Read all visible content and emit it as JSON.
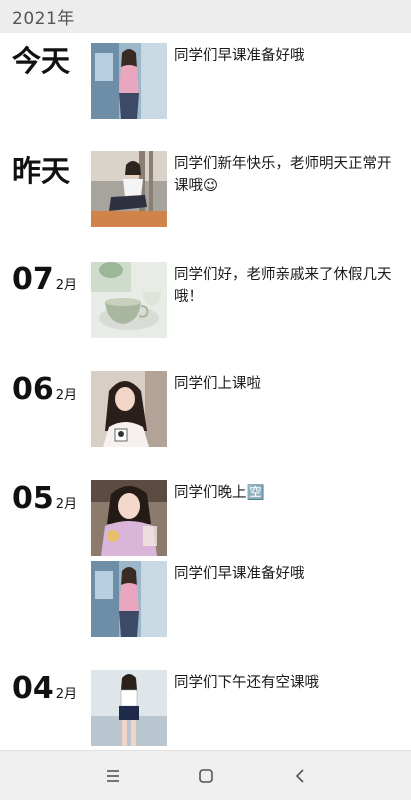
{
  "header": {
    "year": "2021年"
  },
  "days": [
    {
      "label": "今天",
      "posts": [
        {
          "text": "同学们早课准备好哦",
          "thumb": "photo-woman-window-pink"
        }
      ]
    },
    {
      "label": "昨天",
      "posts": [
        {
          "text": "同学们新年快乐，老师明天正常开课哦😉",
          "thumb": "photo-woman-gym-sitting"
        }
      ]
    },
    {
      "day": "07",
      "month": "2月",
      "posts": [
        {
          "text": "同学们好，老师亲戚来了休假几天哦！",
          "thumb": "photo-teacup"
        }
      ]
    },
    {
      "day": "06",
      "month": "2月",
      "posts": [
        {
          "text": "同学们上课啦",
          "thumb": "photo-woman-selfie"
        }
      ]
    },
    {
      "day": "05",
      "month": "2月",
      "posts": [
        {
          "text": "同学们晚上🈳",
          "thumb": "photo-woman-pink-dress"
        },
        {
          "text": "同学们早课准备好哦",
          "thumb": "photo-woman-window-pink"
        }
      ]
    },
    {
      "day": "04",
      "month": "2月",
      "posts": [
        {
          "text": "同学们下午还有空课哦",
          "thumb": "photo-woman-standing"
        }
      ]
    }
  ],
  "nav": {
    "icons": [
      "menu-icon",
      "home-icon",
      "back-icon"
    ]
  }
}
